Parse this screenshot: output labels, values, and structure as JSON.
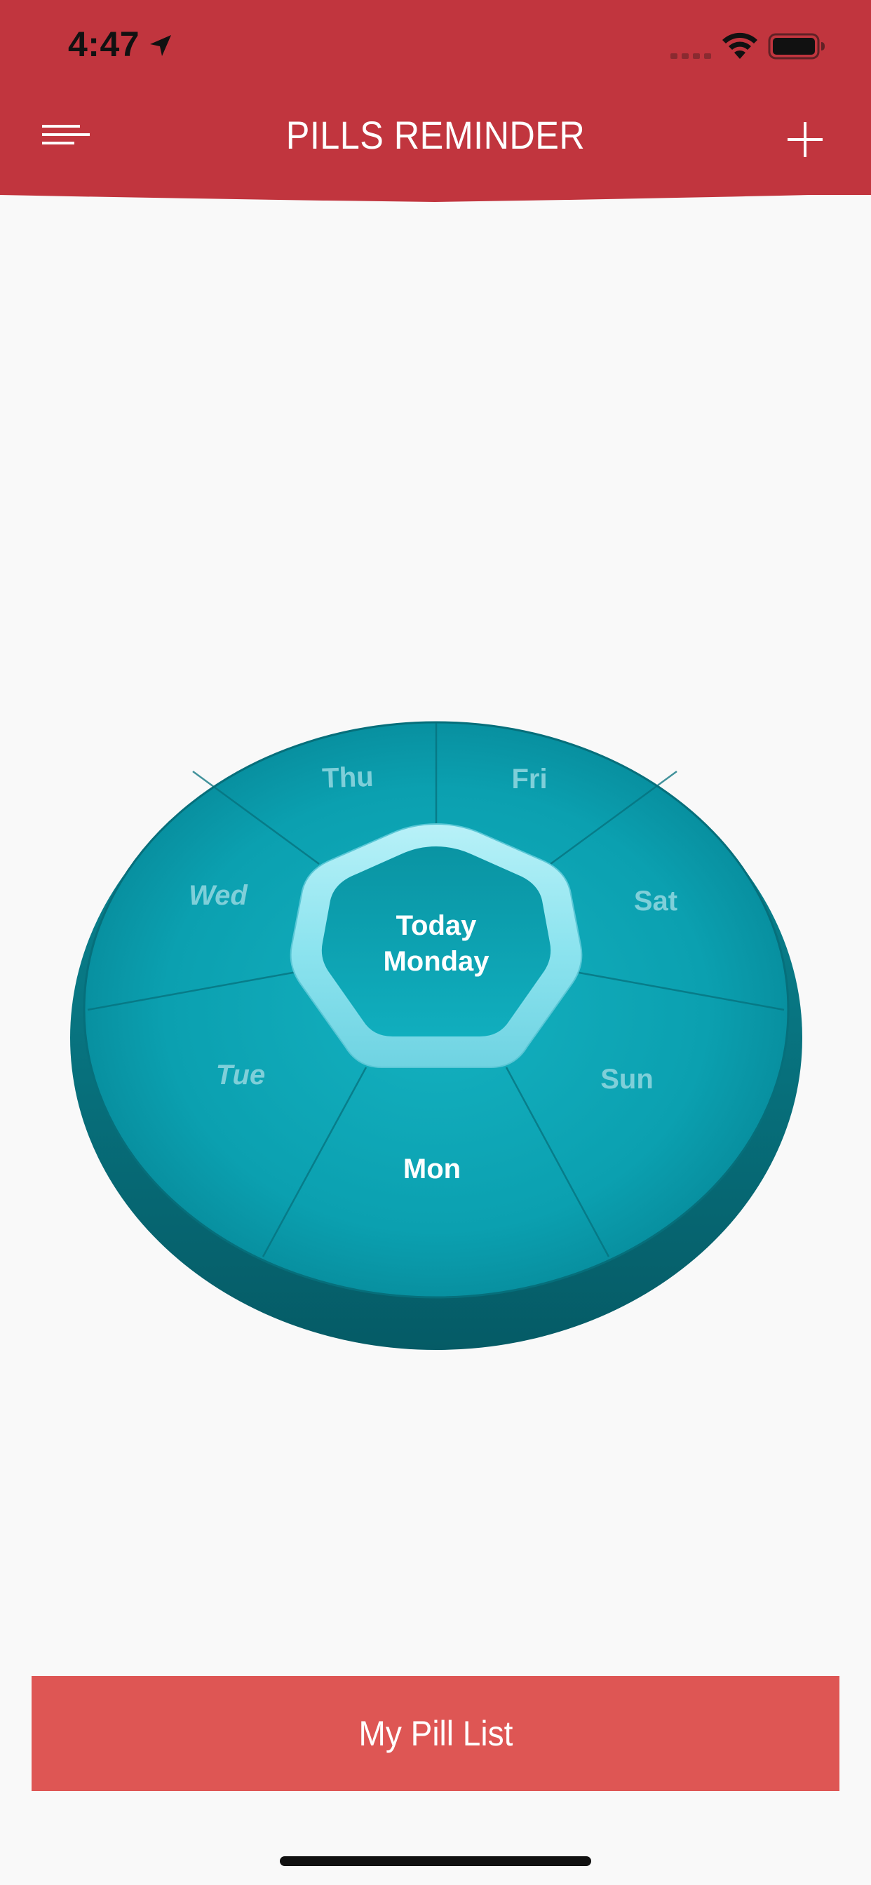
{
  "status_bar": {
    "time": "4:47",
    "icons": [
      "location-arrow-icon",
      "cellular-signal-icon",
      "wifi-icon",
      "battery-icon"
    ]
  },
  "header": {
    "title": "PILLS REMINDER",
    "menu_icon": "menu-icon",
    "add_icon": "plus-icon",
    "background_color": "#c1353e"
  },
  "pill_box": {
    "center": {
      "line1": "Today",
      "line2": "Monday"
    },
    "days": {
      "thu": "Thu",
      "fri": "Fri",
      "wed": "Wed",
      "sat": "Sat",
      "tue": "Tue",
      "sun": "Sun",
      "mon": "Mon"
    },
    "selected_day": "Mon",
    "color": "#0ea3b3"
  },
  "bottom_button": {
    "label": "My Pill List",
    "background_color": "#de5654"
  }
}
